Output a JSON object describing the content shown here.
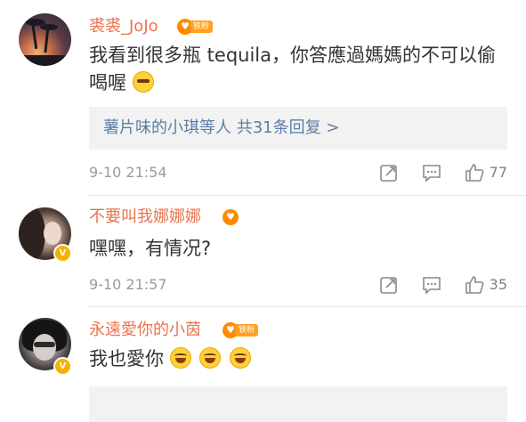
{
  "comments": [
    {
      "username": "裘裘_JoJo",
      "fan_badge": "铁粉",
      "text_lines": [
        "我看到很多瓶 tequila，你答應過媽媽的不可以偷",
        "喝喔"
      ],
      "replies_label": "薯片味的小琪等人 共31条回复 >",
      "timestamp": "9-10 21:54",
      "like_count": "77",
      "emoji": "cool-emoji"
    },
    {
      "username": "不要叫我娜娜娜",
      "verified": "V",
      "text": "嘿嘿，有情况?",
      "timestamp": "9-10 21:57",
      "like_count": "35"
    },
    {
      "username": "永遠愛你的小茵",
      "fan_badge": "铁粉",
      "verified": "V",
      "text": "我也愛你",
      "emoji": "laughing-crying-emoji"
    }
  ],
  "icons": {
    "share": "share-icon",
    "comment": "comment-icon",
    "like": "thumbs-up-icon"
  },
  "colors": {
    "username": "#eb7350",
    "reply_link": "#5b7ea5",
    "reply_bg": "#f2f2f2",
    "fan_badge": "#ffa21f",
    "verified_badge": "#f5b200"
  }
}
